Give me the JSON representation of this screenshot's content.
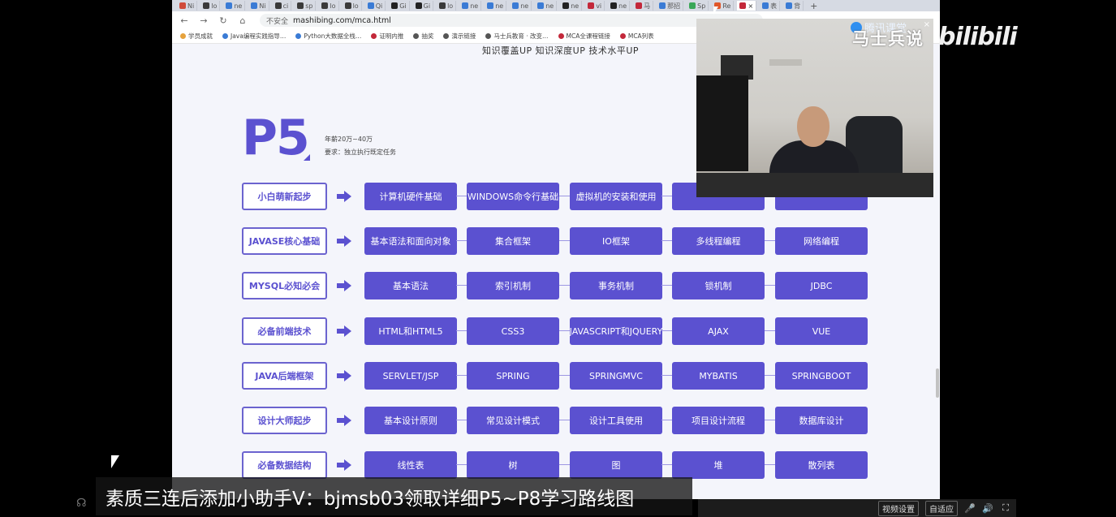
{
  "browser": {
    "tabs": [
      {
        "label": "Ni",
        "color": "#d04b3a"
      },
      {
        "label": "lo",
        "color": "#3a3a3a"
      },
      {
        "label": "ne",
        "color": "#3a7bd5"
      },
      {
        "label": "Ni",
        "color": "#3a7bd5"
      },
      {
        "label": "ci",
        "color": "#3a3a3a"
      },
      {
        "label": "sp",
        "color": "#3a3a3a"
      },
      {
        "label": "lo",
        "color": "#3a3a3a"
      },
      {
        "label": "lo",
        "color": "#3a3a3a"
      },
      {
        "label": "Qi",
        "color": "#3a7bd5"
      },
      {
        "label": "Gi",
        "color": "#222222"
      },
      {
        "label": "Gi",
        "color": "#222222"
      },
      {
        "label": "lo",
        "color": "#3a3a3a"
      },
      {
        "label": "ne",
        "color": "#3a7bd5"
      },
      {
        "label": "ne",
        "color": "#3a7bd5"
      },
      {
        "label": "ne",
        "color": "#3a7bd5"
      },
      {
        "label": "ne",
        "color": "#3a7bd5"
      },
      {
        "label": "ne",
        "color": "#222222"
      },
      {
        "label": "vi",
        "color": "#c3283a"
      },
      {
        "label": "ne",
        "color": "#222222"
      },
      {
        "label": "马",
        "color": "#c3283a"
      },
      {
        "label": "那招",
        "color": "#3a7bd5"
      },
      {
        "label": "Sp",
        "color": "#3aa757"
      },
      {
        "label": "Re",
        "color": "#e0572a"
      },
      {
        "label": "×",
        "color": "#c3283a"
      },
      {
        "label": "表",
        "color": "#3a7bd5"
      },
      {
        "label": "背",
        "color": "#3a7bd5"
      }
    ],
    "new_tab": "+",
    "nav": {
      "back": "←",
      "forward": "→",
      "reload": "↻",
      "home": "⌂"
    },
    "insecure_label": "不安全",
    "url": "mashibing.com/mca.html",
    "bookmarks": [
      {
        "label": "学员成就",
        "color": "#e6a23c"
      },
      {
        "label": "Java编程实践指导…",
        "color": "#3a7bd5"
      },
      {
        "label": "Python大数据全栈…",
        "color": "#3a7bd5"
      },
      {
        "label": "证明内推",
        "color": "#c3283a"
      },
      {
        "label": "抽奖",
        "color": "#555555"
      },
      {
        "label": "演示链接",
        "color": "#555555"
      },
      {
        "label": "马士兵教育 · 改变…",
        "color": "#555555"
      },
      {
        "label": "MCA全课程链接",
        "color": "#c3283a"
      },
      {
        "label": "MCA列表",
        "color": "#c3283a"
      }
    ]
  },
  "page": {
    "tagline": "知识覆盖UP 知识深度UP 技术水平UP",
    "level": "P5",
    "salary": "年薪20万~40万",
    "requirement": "要求：独立执行既定任务",
    "rows": [
      {
        "category": "小白萌新起步",
        "items": [
          "计算机硬件基础",
          "WINDOWS命令行基础",
          "虚拟机的安装和使用",
          "",
          ""
        ]
      },
      {
        "category": "JAVASE核心基础",
        "items": [
          "基本语法和面向对象",
          "集合框架",
          "IO框架",
          "多线程编程",
          "网络编程"
        ]
      },
      {
        "category": "MYSQL必知必会",
        "items": [
          "基本语法",
          "索引机制",
          "事务机制",
          "锁机制",
          "JDBC"
        ]
      },
      {
        "category": "必备前端技术",
        "items": [
          "HTML和HTML5",
          "CSS3",
          "JAVASCRIPT和JQUERY",
          "AJAX",
          "VUE"
        ]
      },
      {
        "category": "JAVA后端框架",
        "items": [
          "SERVLET/JSP",
          "SPRING",
          "SPRINGMVC",
          "MYBATIS",
          "SPRINGBOOT"
        ]
      },
      {
        "category": "设计大师起步",
        "items": [
          "基本设计原则",
          "常见设计模式",
          "设计工具使用",
          "项目设计流程",
          "数据库设计"
        ]
      },
      {
        "category": "必备数据结构",
        "items": [
          "线性表",
          "树",
          "图",
          "堆",
          "散列表"
        ]
      }
    ]
  },
  "overlay": {
    "webcam_brand": "腾讯课堂",
    "webcam_close": "×",
    "channel_logo": "马士兵说",
    "site_logo": "bilibili",
    "caption": "素质三连后添加小助手V：bjmsb03领取详细P5~P8学习路线图"
  },
  "player": {
    "video_settings": "视频设置",
    "auto_fit": "自适应",
    "mic_icon": "🎤",
    "volume_icon": "🔊",
    "fullscreen_icon": "⛶"
  },
  "colors": {
    "accent": "#5b51d0",
    "page_bg": "#f4f5fb"
  }
}
